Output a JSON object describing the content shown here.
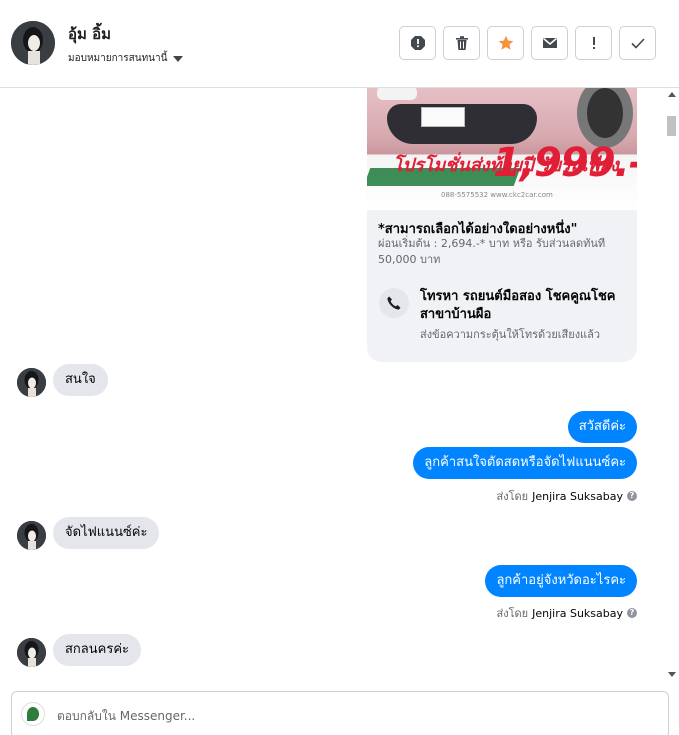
{
  "header": {
    "name": "อุ้ม อิ้ม",
    "assign_label": "มอบหมายการสนทนานี้"
  },
  "toolbar": [
    {
      "name": "spam-icon",
      "title": "spam"
    },
    {
      "name": "trash-icon",
      "title": "delete"
    },
    {
      "name": "star-icon",
      "title": "follow up"
    },
    {
      "name": "envelope-icon",
      "title": "mark unread"
    },
    {
      "name": "exclamation-icon",
      "title": "mark as important"
    },
    {
      "name": "check-icon",
      "title": "mark done"
    }
  ],
  "colors": {
    "accent": "#0084ff",
    "star": "#f7923a",
    "bubble_in": "#e4e6eb"
  },
  "card": {
    "promo_text": "โปรโมชั่นส่งท้ายปี รับรถเพียง",
    "promo_price": "1,999.-",
    "promo_footer": "088-5575532  www.ckc2car.com",
    "title": "*สามารถเลือกได้อย่างใดอย่างหนึ่ง\"",
    "desc": "ผ่อนเริ่มต้น : 2,694.-* บาท  หรือ รับส่วนลดทันที 50,000 บาท"
  },
  "call": {
    "title": "โทรหา รถยนต์มือสอง โชคคูณโชค สาขาบ้านผือ",
    "sub": "ส่งข้อความกระตุ้นให้โทรด้วยเสียงแล้ว"
  },
  "messages": {
    "in1": "สนใจ",
    "out1": "สวัสดีค่ะ",
    "out2": "ลูกค้าสนใจตัดสดหรือจัดไฟแนนซ์คะ",
    "in2": "จัดไฟแนนซ์ค่ะ",
    "out3": "ลูกค้าอยู่จังหวัดอะไรคะ",
    "in3": "สกลนครค่ะ"
  },
  "sent_by": {
    "prefix": "ส่งโดย",
    "agent": "Jenjira Suksabay",
    "help": "?"
  },
  "reply": {
    "placeholder": "ตอบกลับใน Messenger..."
  }
}
